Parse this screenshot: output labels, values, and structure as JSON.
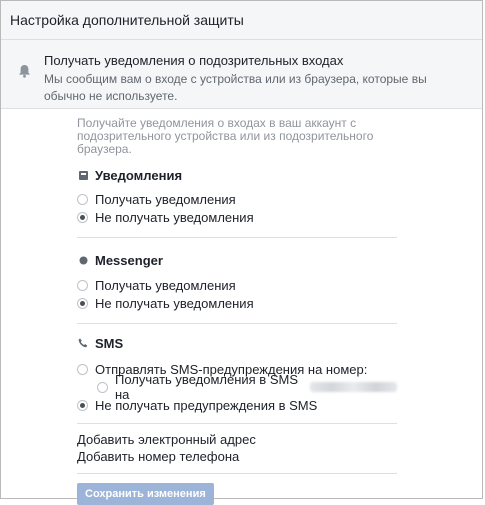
{
  "header": {
    "title": "Настройка дополнительной защиты"
  },
  "intro": {
    "title": "Получать уведомления о подозрительных входах",
    "subtitle": "Мы сообщим вам о входе с устройства или из браузера, которые вы обычно не используете.",
    "icon": "bell-icon"
  },
  "description": "Получайте уведомления о входах в ваш аккаунт с подозрительного устройства или из подозрительного браузера.",
  "notifications": {
    "title": "Уведомления",
    "icon": "notification-square-icon",
    "options": [
      "Получать уведомления",
      "Не получать уведомления"
    ],
    "selected": 1
  },
  "messenger": {
    "title": "Messenger",
    "icon": "messenger-dot-icon",
    "options": [
      "Получать уведомления",
      "Не получать уведомления"
    ],
    "selected": 1
  },
  "sms": {
    "title": "SMS",
    "icon": "phone-icon",
    "option_send": "Отправлять SMS-предупреждения на номер:",
    "option_sub": "Получать уведомления в SMS на",
    "option_none": "Не получать предупреждения в SMS",
    "selected": 2
  },
  "links": {
    "add_email": "Добавить электронный адрес",
    "add_phone": "Добавить номер телефона"
  },
  "save_button": "Сохранить изменения"
}
